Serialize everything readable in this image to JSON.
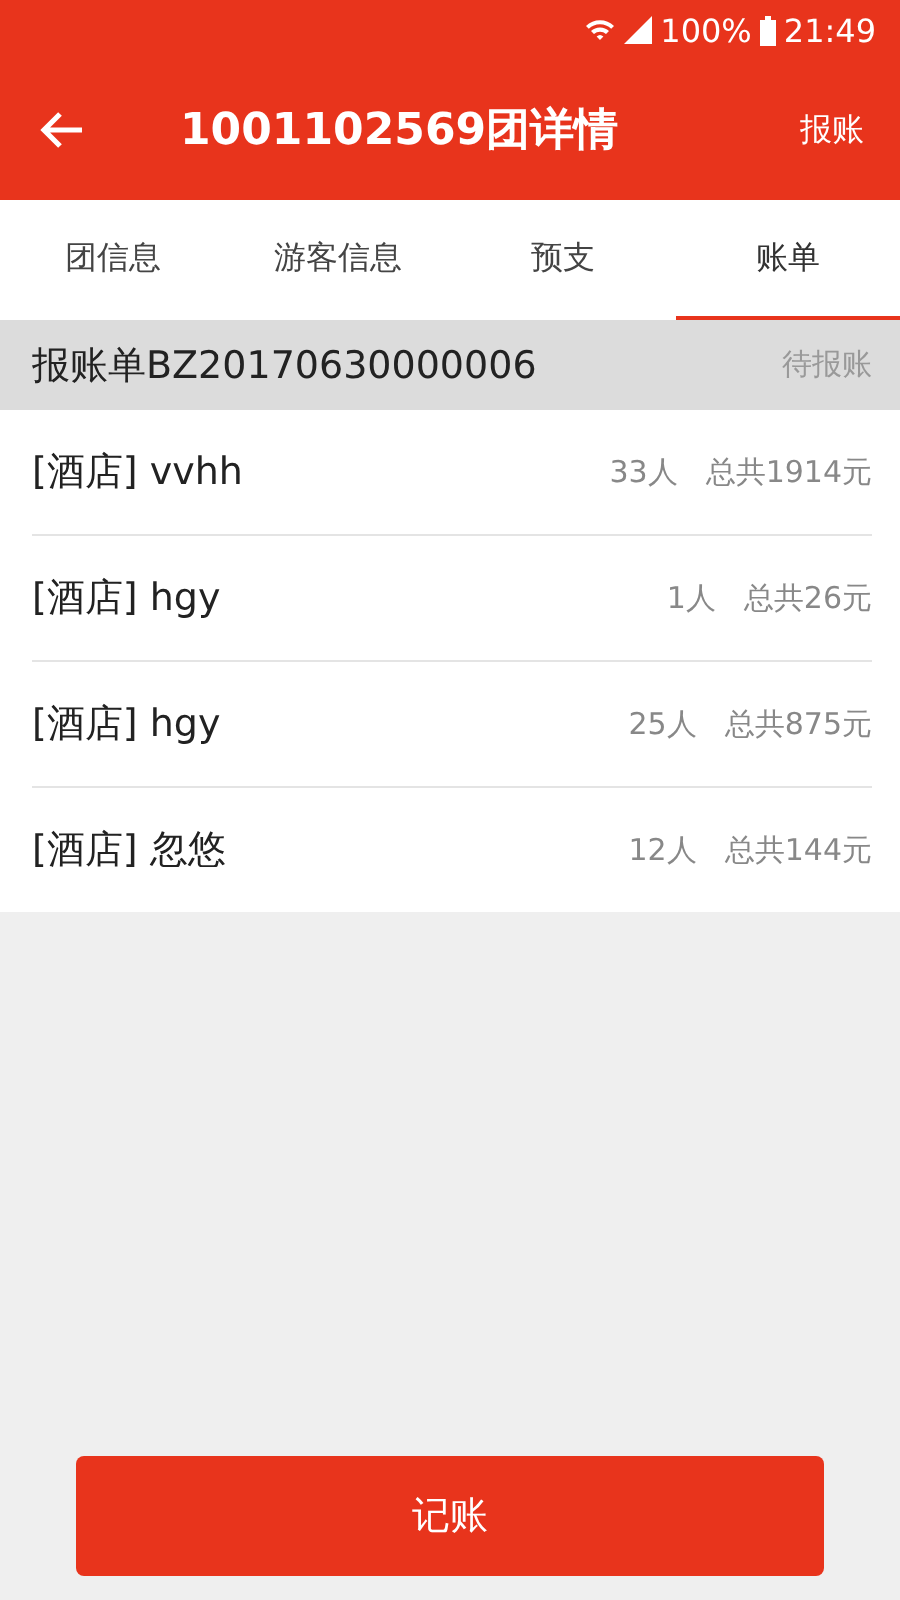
{
  "status_bar": {
    "battery": "100%",
    "time": "21:49"
  },
  "header": {
    "title": "1001102569团详情",
    "action": "报账"
  },
  "tabs": [
    {
      "label": "团信息",
      "selected": false
    },
    {
      "label": "游客信息",
      "selected": false
    },
    {
      "label": "预支",
      "selected": false
    },
    {
      "label": "账单",
      "selected": true
    }
  ],
  "bill": {
    "number": "报账单BZ20170630000006",
    "status": "待报账"
  },
  "items": [
    {
      "name": "[酒店] vvhh",
      "people": "33人",
      "total": "总共1914元"
    },
    {
      "name": "[酒店] hgy",
      "people": "1人",
      "total": "总共26元"
    },
    {
      "name": "[酒店] hgy",
      "people": "25人",
      "total": "总共875元"
    },
    {
      "name": "[酒店] 忽悠",
      "people": "12人",
      "total": "总共144元"
    }
  ],
  "button": "记账"
}
